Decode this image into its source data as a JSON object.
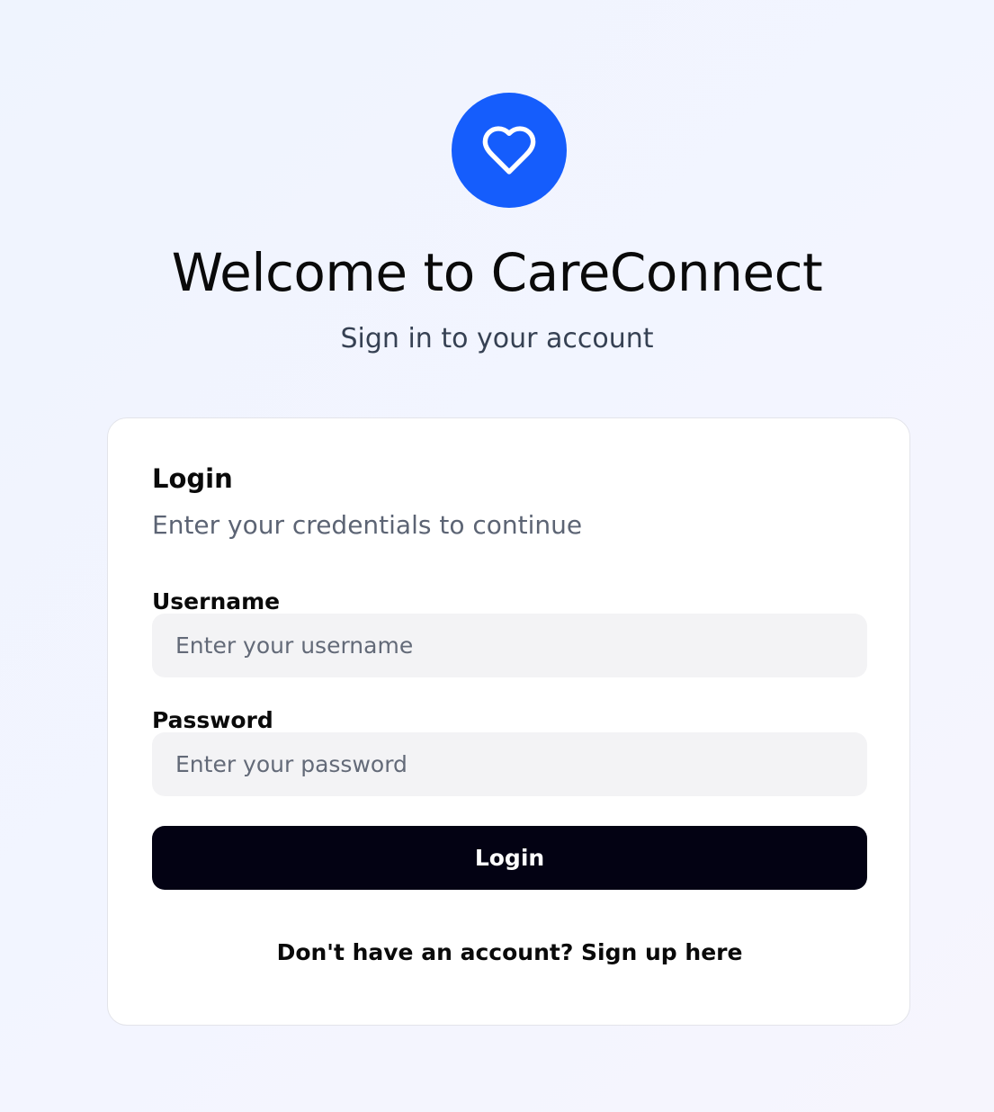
{
  "branding": {
    "logo_icon": "heart-icon",
    "accent_color": "#155dfc",
    "title": "Welcome to CareConnect",
    "subtitle": "Sign in to your account"
  },
  "login_card": {
    "title": "Login",
    "description": "Enter your credentials to continue",
    "username": {
      "label": "Username",
      "value": "",
      "placeholder": "Enter your username"
    },
    "password": {
      "label": "Password",
      "value": "",
      "placeholder": "Enter your password"
    },
    "submit_label": "Login",
    "submit_color": "#030213",
    "signup_text": "Don't have an account? Sign up here"
  }
}
